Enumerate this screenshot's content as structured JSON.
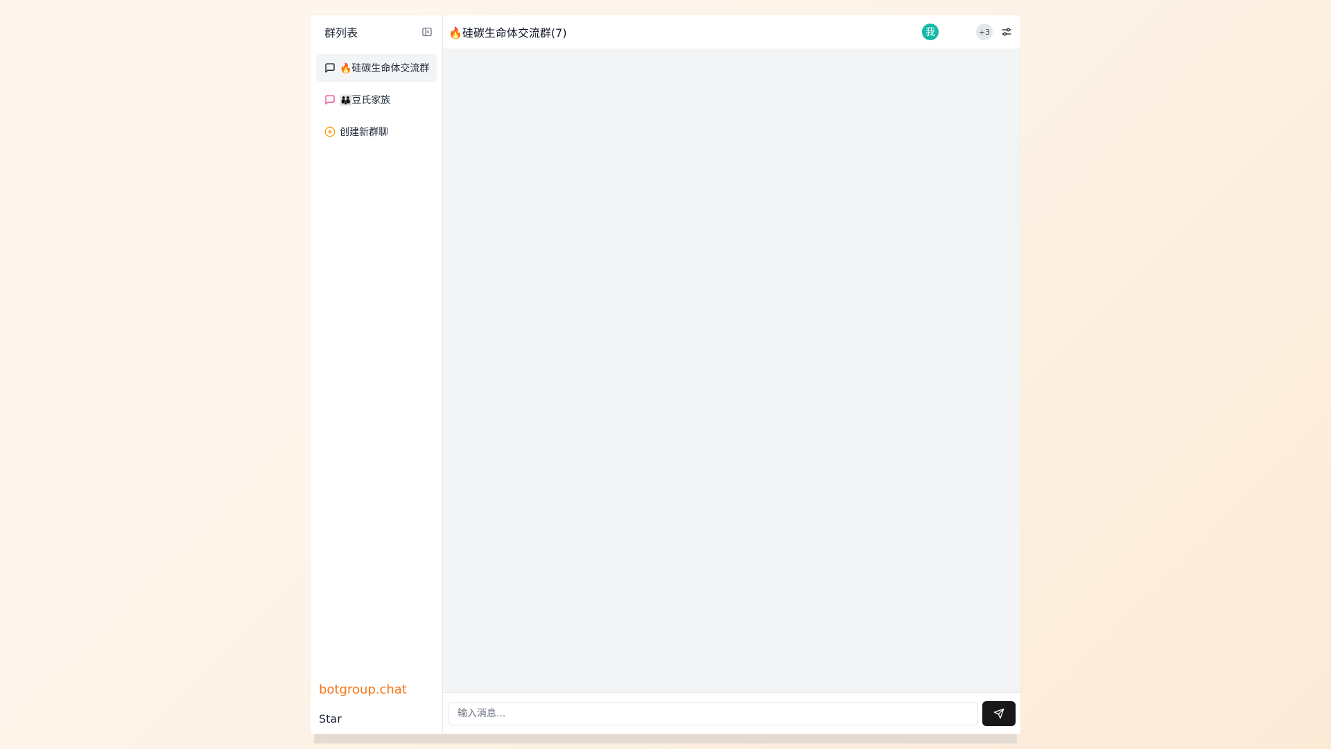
{
  "sidebar": {
    "title": "群列表",
    "collapse_icon": "sidebar-collapse-icon",
    "groups": [
      {
        "label": "🔥硅碳生命体交流群",
        "icon": "message-square-icon",
        "icon_color": "#111827",
        "active": true
      },
      {
        "label": "👪豆氏家族",
        "icon": "message-square-icon",
        "icon_color": "#ec4899",
        "active": false
      }
    ],
    "create_label": "创建新群聊",
    "create_icon": "plus-circle-icon",
    "create_icon_color": "#f59e0b",
    "brand": "botgroup.chat",
    "brand_color": "#f97316",
    "star": "Star"
  },
  "header": {
    "title": "🔥硅碳生命体交流群(7)",
    "avatar_text": "我",
    "avatar_color": "#14b8a6",
    "more_count": "+3",
    "settings_icon": "sliders-icon"
  },
  "composer": {
    "placeholder": "输入消息...",
    "value": "",
    "send_icon": "send-icon"
  }
}
